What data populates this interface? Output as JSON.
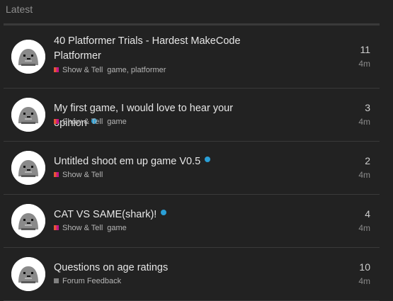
{
  "section": {
    "title": "Latest"
  },
  "topics": [
    {
      "title": "40 Platformer Trials - Hardest MakeCode Platformer",
      "category": "Show & Tell",
      "tags": "game, platformer",
      "new": false,
      "replies": "11",
      "activity": "4m",
      "category_icon": "split-badge"
    },
    {
      "title": "My first game, I would love to hear your opinion",
      "category": "Show & Tell",
      "tags": "game",
      "new": true,
      "replies": "3",
      "activity": "4m",
      "category_icon": "split-badge"
    },
    {
      "title": "Untitled shoot em up game V0.5",
      "category": "Show & Tell",
      "tags": "",
      "new": true,
      "replies": "2",
      "activity": "4m",
      "category_icon": "split-badge"
    },
    {
      "title": "CAT VS SAME(shark)!",
      "category": "Show & Tell",
      "tags": "game",
      "new": true,
      "replies": "4",
      "activity": "4m",
      "category_icon": "split-badge"
    },
    {
      "title": "Questions on age ratings",
      "category": "Forum Feedback",
      "tags": "",
      "new": false,
      "replies": "10",
      "activity": "4m",
      "category_icon": "gray-badge"
    }
  ],
  "colors": {
    "background": "#222222",
    "new_dot": "#2a9fd6",
    "category_orange": "#e45735",
    "category_magenta": "#c71585",
    "category_gray": "#808080"
  }
}
